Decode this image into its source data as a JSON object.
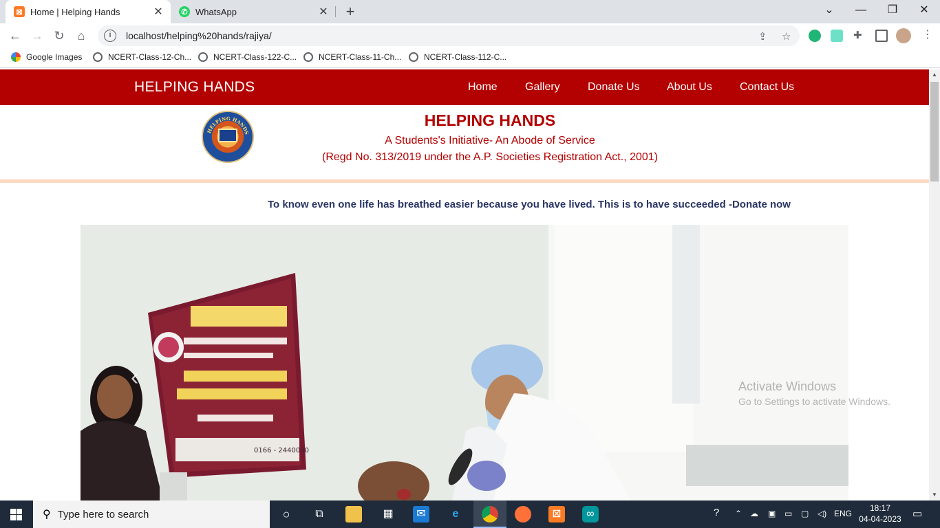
{
  "browser": {
    "tabs": [
      {
        "title": "Home | Helping Hands",
        "active": true,
        "icon": "xampp-icon"
      },
      {
        "title": "WhatsApp",
        "active": false,
        "icon": "whatsapp-icon"
      }
    ],
    "url": "localhost/helping%20hands/rajiya/",
    "bookmarks": [
      {
        "label": "Google Images",
        "icon": "google-icon"
      },
      {
        "label": "NCERT-Class-12-Ch...",
        "icon": "globe-icon"
      },
      {
        "label": "NCERT-Class-122-C...",
        "icon": "globe-icon"
      },
      {
        "label": "NCERT-Class-11-Ch...",
        "icon": "globe-icon"
      },
      {
        "label": "NCERT-Class-112-C...",
        "icon": "globe-icon"
      }
    ]
  },
  "site": {
    "brand": "HELPING HANDS",
    "nav": [
      "Home",
      "Gallery",
      "Donate Us",
      "About Us",
      "Contact Us"
    ],
    "org_title": "HELPING HANDS",
    "org_subtitle": "A Students's Initiative- An Abode of Service",
    "org_registration": "(Regd No. 313/2019 under the A.P. Societies Registration Act., 2001)",
    "logo_text": "HELPING HANDS",
    "quote": "To know even one life has breathed easier because you have lived. This is to have succeeded -Donate now",
    "carousel_prev": "‹",
    "banner_phone": "0166 - 2440030",
    "colors": {
      "primary": "#b30000",
      "band_border": "#fcd9c0",
      "quote": "#2a3563"
    }
  },
  "watermark": {
    "line1": "Activate Windows",
    "line2": "Go to Settings to activate Windows."
  },
  "taskbar": {
    "search_placeholder": "Type here to search",
    "language": "ENG",
    "time": "18:17",
    "date": "04-04-2023"
  }
}
